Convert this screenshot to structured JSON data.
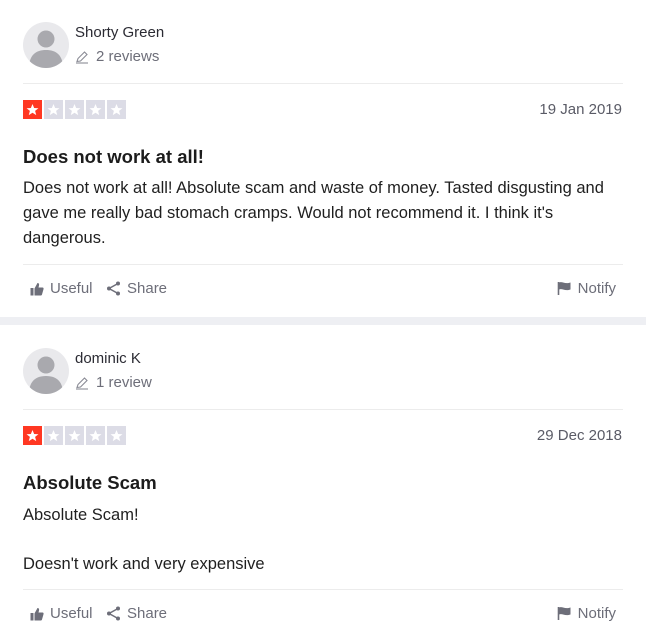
{
  "reviews": [
    {
      "reviewer_name": "Shorty Green",
      "review_count": "2 reviews",
      "rating": 1,
      "max_rating": 5,
      "date": "19 Jan 2019",
      "title": "Does not work at all!",
      "paragraphs": [
        "Does not work at all! Absolute scam and waste of money. Tasted disgusting and gave me really bad stomach cramps. Would not recommend it. I think it's dangerous."
      ],
      "actions": {
        "useful": "Useful",
        "share": "Share",
        "notify": "Notify"
      }
    },
    {
      "reviewer_name": "dominic K",
      "review_count": "1 review",
      "rating": 1,
      "max_rating": 5,
      "date": "29 Dec 2018",
      "title": "Absolute Scam",
      "paragraphs": [
        "Absolute Scam!",
        "Doesn't work and very expensive"
      ],
      "actions": {
        "useful": "Useful",
        "share": "Share",
        "notify": "Notify"
      }
    }
  ],
  "colors": {
    "star_filled": "#ff3722",
    "star_empty": "#dcdce6",
    "muted_text": "#6d6e79",
    "separator": "#eeeff3"
  },
  "icons": {
    "avatar": "default-user-avatar-icon",
    "review_count": "pencil-icon",
    "star": "star-icon",
    "useful": "thumbs-up-icon",
    "share": "share-icon",
    "notify": "flag-icon"
  }
}
